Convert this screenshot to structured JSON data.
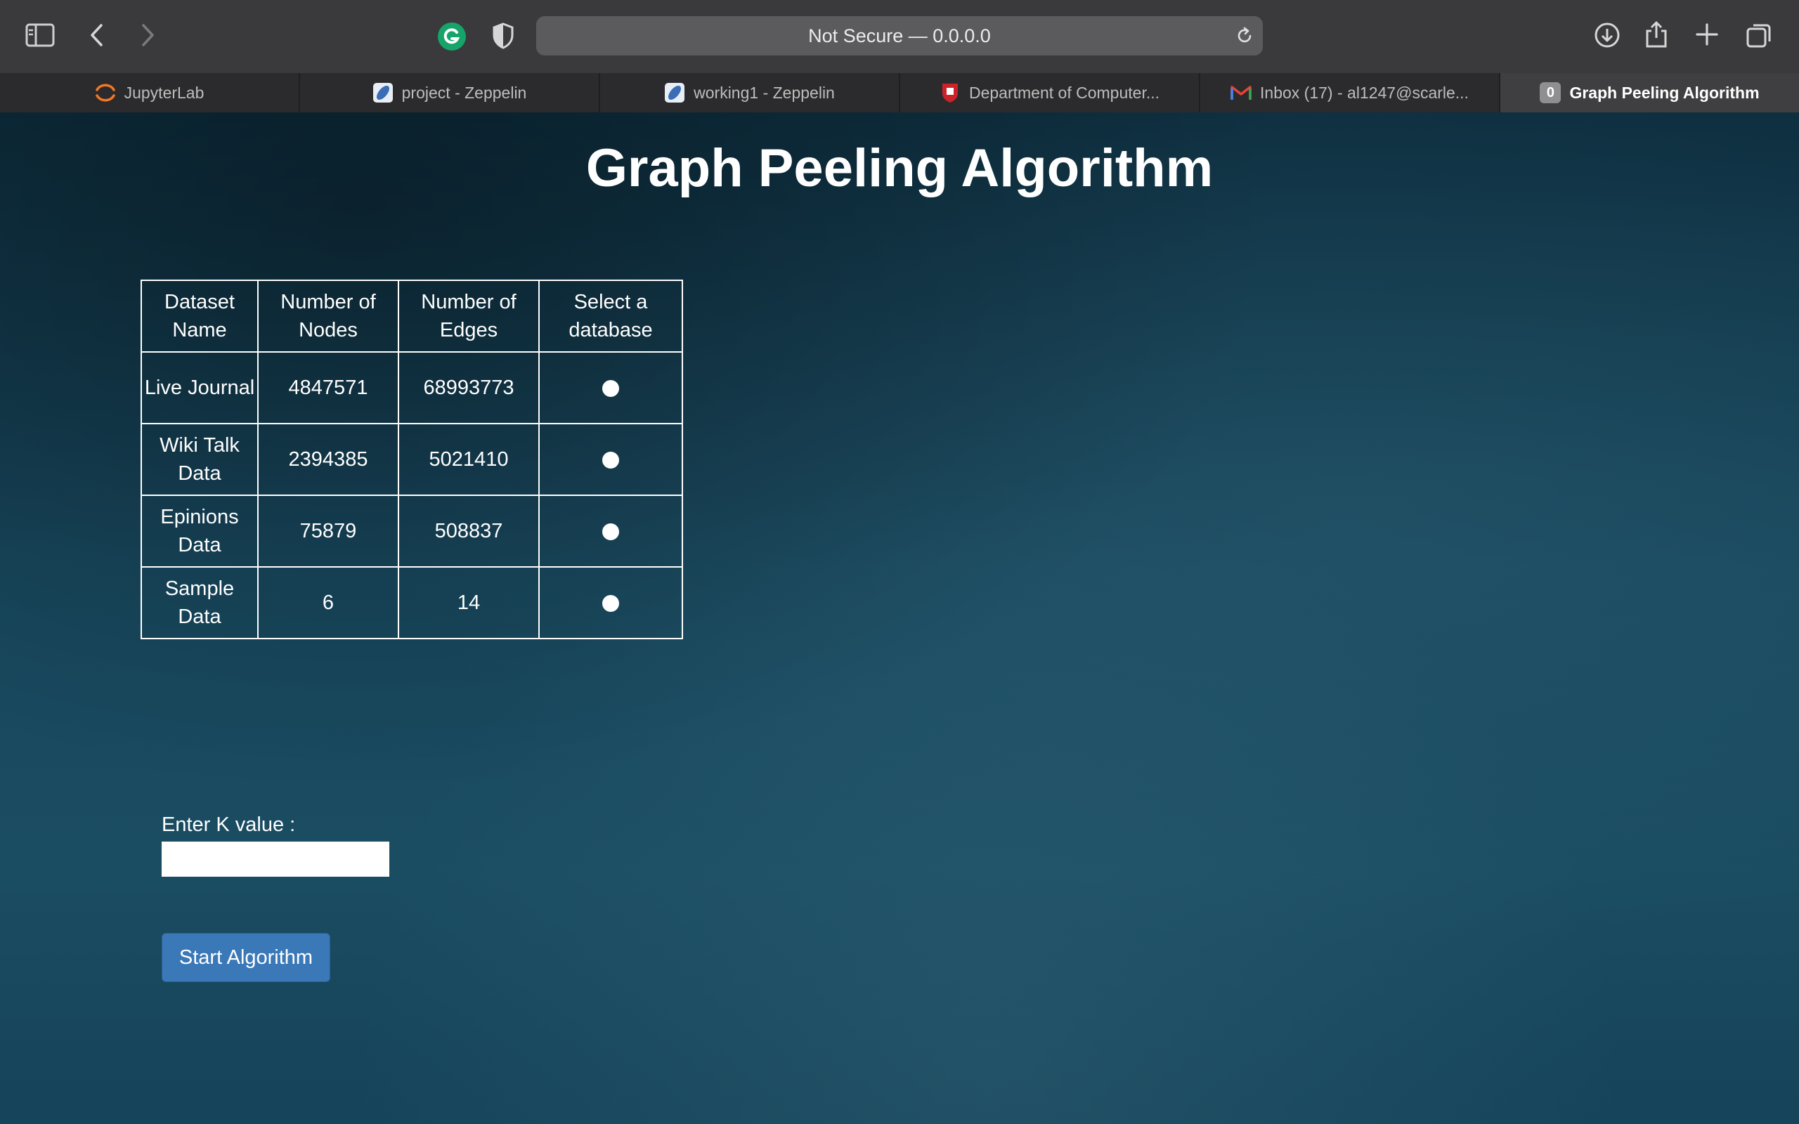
{
  "browser": {
    "address": "Not Secure — 0.0.0.0",
    "tabs": [
      {
        "label": "JupyterLab",
        "icon": "jupyter-icon"
      },
      {
        "label": "project - Zeppelin",
        "icon": "zeppelin-icon"
      },
      {
        "label": "working1 - Zeppelin",
        "icon": "zeppelin-icon"
      },
      {
        "label": "Department of Computer...",
        "icon": "shield-crest-icon"
      },
      {
        "label": "Inbox (17) - al1247@scarle...",
        "icon": "gmail-icon"
      },
      {
        "label": "Graph Peeling Algorithm",
        "icon": "badge-icon",
        "badge": "0",
        "active": true
      }
    ]
  },
  "page": {
    "title": "Graph Peeling Algorithm",
    "table": {
      "headers": [
        "Dataset Name",
        "Number of Nodes",
        "Number of Edges",
        "Select a database"
      ],
      "rows": [
        {
          "name": "Live Journal",
          "nodes": "4847571",
          "edges": "68993773"
        },
        {
          "name": "Wiki Talk Data",
          "nodes": "2394385",
          "edges": "5021410"
        },
        {
          "name": "Epinions Data",
          "nodes": "75879",
          "edges": "508837"
        },
        {
          "name": "Sample Data",
          "nodes": "6",
          "edges": "14"
        }
      ]
    },
    "k_label": "Enter K value :",
    "k_value": "",
    "start_button": "Start Algorithm"
  },
  "colors": {
    "accent_button": "#3a78b8",
    "background": "#0f3648",
    "toolbar": "#3a3a3c"
  }
}
